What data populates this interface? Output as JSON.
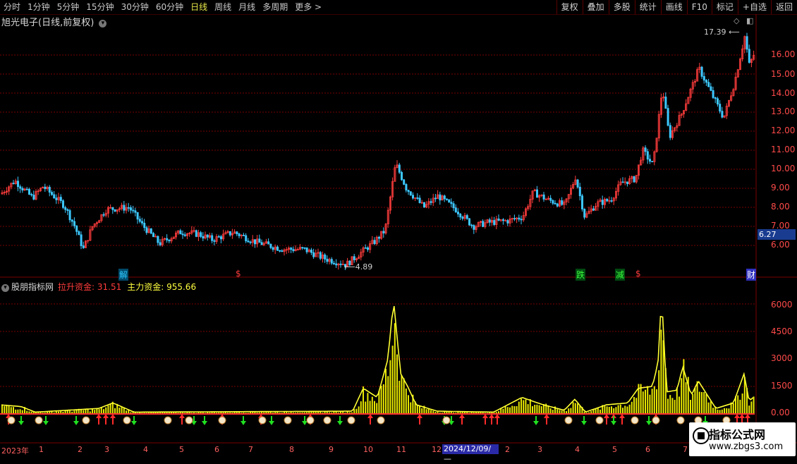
{
  "toolbar": {
    "periods": [
      "分时",
      "1分钟",
      "5分钟",
      "15分钟",
      "30分钟",
      "60分钟",
      "日线",
      "周线",
      "月线",
      "多周期",
      "更多 >"
    ],
    "active": "日线",
    "right": [
      "复权",
      "叠加",
      "多股",
      "统计",
      "画线",
      "F10",
      "标记",
      "+自选",
      "返回"
    ]
  },
  "stock_title": "旭光电子(日线,前复权)",
  "price_axis": [
    "16.00",
    "15.00",
    "14.00",
    "13.00",
    "12.00",
    "11.00",
    "10.00",
    "9.00",
    "8.00",
    "7.00",
    "6.00"
  ],
  "current_price": "6.27",
  "high_label": "17.39",
  "low_label": "4.89",
  "events": [
    {
      "text": "解",
      "color": "#2fc8ff",
      "bg": "#004a6a"
    },
    {
      "text": "$",
      "color": "#ff3c3c",
      "bg": "transparent"
    },
    {
      "text": "跌",
      "color": "#3cff3c",
      "bg": "#004a10"
    },
    {
      "text": "减",
      "color": "#3cff3c",
      "bg": "#004a10"
    },
    {
      "text": "$",
      "color": "#ff3c3c",
      "bg": "transparent"
    },
    {
      "text": "财",
      "color": "#ffffff",
      "bg": "#3030c0"
    }
  ],
  "indicator": {
    "name": "股朋指标网",
    "label1": "拉升资金: 31.51",
    "label2": "主力资金: 955.66",
    "axis": [
      "6000",
      "4500",
      "3000",
      "1500",
      "0.00"
    ]
  },
  "x_axis": [
    "2023年",
    "1",
    "2",
    "3",
    "4",
    "5",
    "6",
    "7",
    "8",
    "9",
    "10",
    "11",
    "12",
    "2",
    "3",
    "4",
    "5",
    "6",
    "7"
  ],
  "date_box": "2024/12/09/—",
  "watermark": {
    "title": "指标公式网",
    "url": "www.zbgs3.com"
  },
  "colors": {
    "up": "#ff3c3c",
    "down": "#3cc8ff",
    "grid": "#7a0000",
    "bar": "#e8e800",
    "line": "#ffff33"
  }
}
